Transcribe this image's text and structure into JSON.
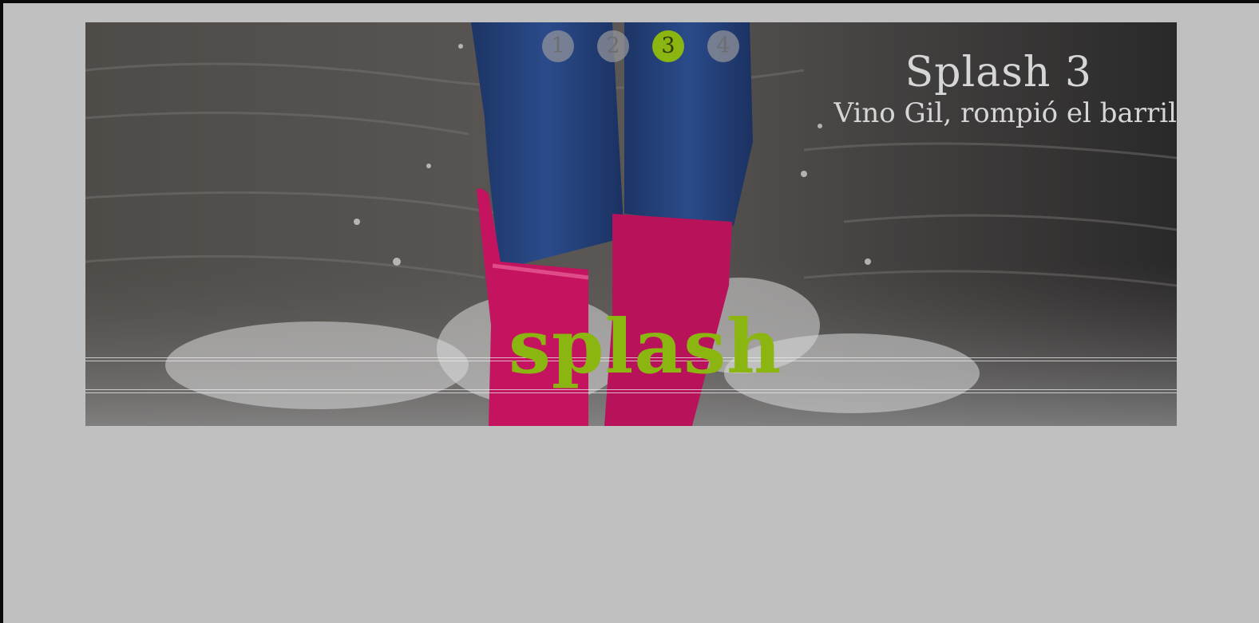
{
  "slider": {
    "pagination": [
      "1",
      "2",
      "3",
      "4"
    ],
    "active_index": 2,
    "active_color": "#8bb511",
    "caption": {
      "title": "Splash 3",
      "subtitle": "Vino Gil, rompió el barril"
    },
    "brand_text": "splash",
    "image_description_icon": "rain-boots-splash-photo"
  }
}
